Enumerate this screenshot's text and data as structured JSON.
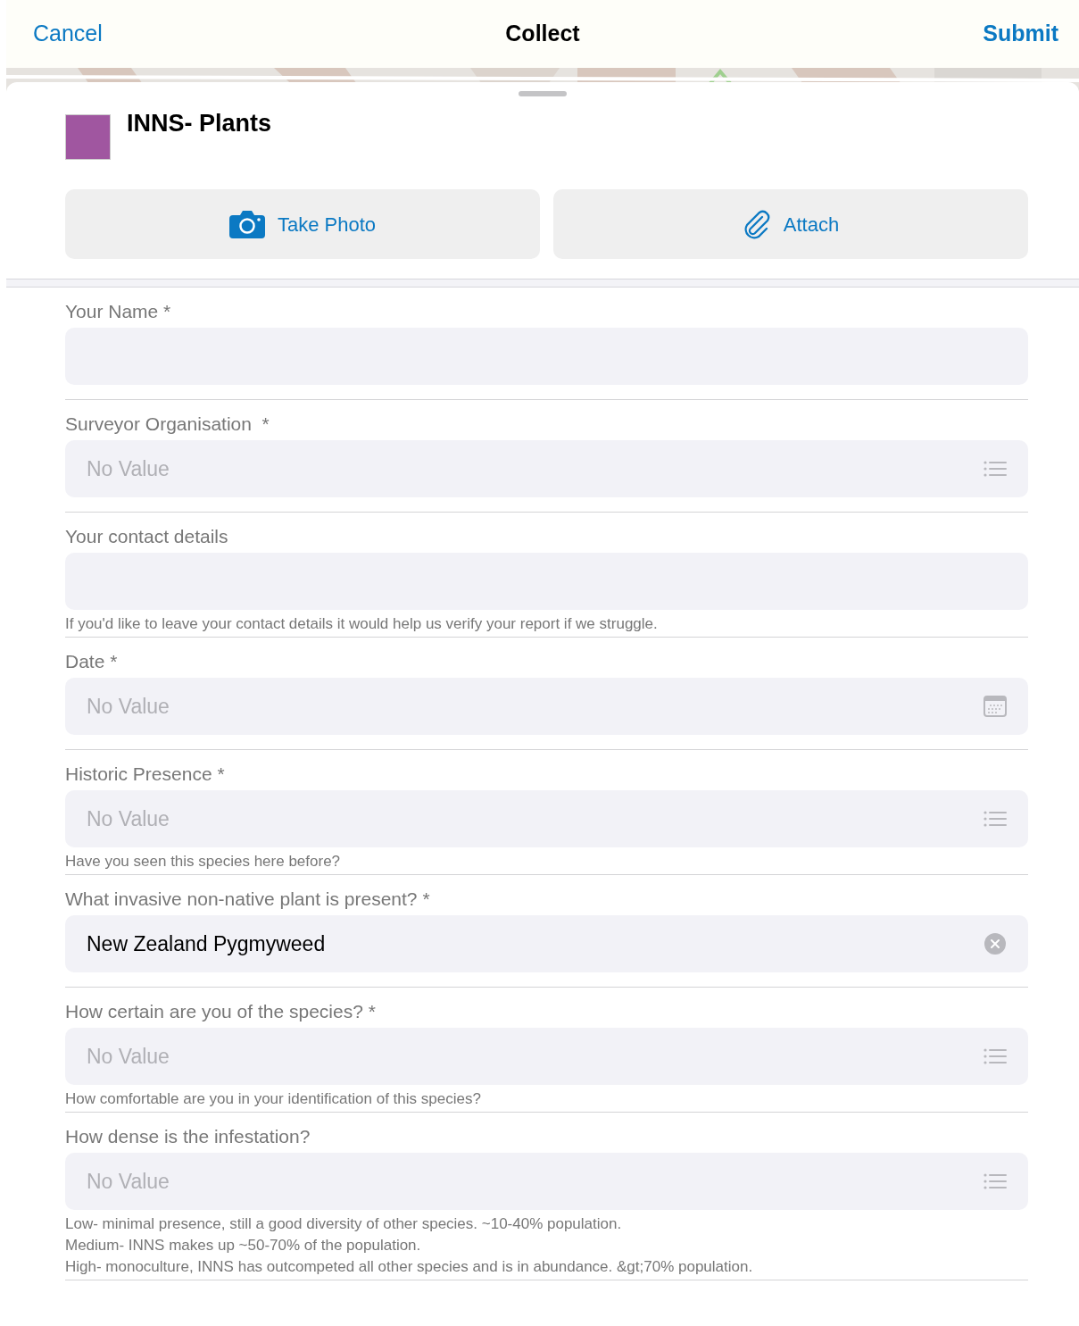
{
  "nav": {
    "cancel": "Cancel",
    "title": "Collect",
    "submit": "Submit"
  },
  "layer": {
    "name": "INNS- Plants",
    "color": "#a056a0"
  },
  "actions": [
    {
      "kind": "camera",
      "label": "Take Photo"
    },
    {
      "kind": "attach",
      "label": "Attach"
    }
  ],
  "fields": [
    {
      "label": "Your Name *",
      "kind": "text"
    },
    {
      "label": "Surveyor Organisation  *",
      "kind": "list",
      "placeholder": "No Value"
    },
    {
      "label": "Your contact details",
      "kind": "text",
      "help": [
        "If you'd like to leave your contact details it would help us verify your report if we struggle."
      ]
    },
    {
      "label": "Date *",
      "kind": "date",
      "placeholder": "No Value"
    },
    {
      "label": "Historic Presence *",
      "kind": "list",
      "placeholder": "No Value",
      "help": [
        "Have you seen this species here before?"
      ]
    },
    {
      "label": "What invasive non-native plant is present? *",
      "kind": "clear",
      "value": "New Zealand Pygmyweed"
    },
    {
      "label": "How certain are you of the species? *",
      "kind": "list",
      "placeholder": "No Value",
      "help": [
        "How comfortable are you in your identification of this species?"
      ]
    },
    {
      "label": "How dense is the infestation?",
      "kind": "list",
      "placeholder": "No Value",
      "help": [
        "Low- minimal presence, still a good diversity of other species. ~10-40% population.",
        "Medium- INNS makes up ~50-70% of the population.",
        "High- monoculture, INNS has outcompeted all other species and is in abundance. &gt;70% population."
      ]
    }
  ]
}
